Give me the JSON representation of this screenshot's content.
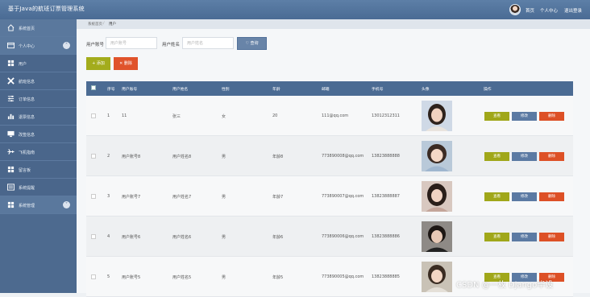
{
  "app": {
    "title": "基于Java的航班订票管理系统"
  },
  "header": {
    "links": [
      "首页",
      "个人中心",
      "退出登录"
    ]
  },
  "sidebar": {
    "items": [
      {
        "label": "系统首页",
        "icon": "home-icon",
        "kind": "top"
      },
      {
        "label": "个人中心",
        "icon": "id-card-icon",
        "kind": "top",
        "expandable": true
      },
      {
        "label": "用户",
        "icon": "grid-icon",
        "kind": "sub"
      },
      {
        "label": "航班信息",
        "icon": "plane-x-icon",
        "kind": "sub"
      },
      {
        "label": "订单信息",
        "icon": "sliders-icon",
        "kind": "sub"
      },
      {
        "label": "退票信息",
        "icon": "bar-chart-icon",
        "kind": "sub"
      },
      {
        "label": "改签信息",
        "icon": "monitor-icon",
        "kind": "sub"
      },
      {
        "label": "飞机指南",
        "icon": "plane-icon",
        "kind": "sub"
      },
      {
        "label": "留言板",
        "icon": "grid-icon",
        "kind": "sub"
      },
      {
        "label": "系统提醒",
        "icon": "list-icon",
        "kind": "sub"
      },
      {
        "label": "系统管理",
        "icon": "grid-icon",
        "kind": "top",
        "expandable": true
      }
    ]
  },
  "breadcrumb": {
    "home": "系统首页",
    "current": "用户"
  },
  "filters": {
    "account_label": "用户账号",
    "account_placeholder": "用户账号",
    "name_label": "用户姓名",
    "name_placeholder": "用户姓名",
    "search_label": "查询"
  },
  "toolbar": {
    "add_label": "添加",
    "delete_label": "删除"
  },
  "table": {
    "columns": [
      "序号",
      "用户账号",
      "用户姓名",
      "性别",
      "年龄",
      "邮箱",
      "手机号",
      "头像",
      "操作"
    ],
    "rows": [
      {
        "index": "1",
        "account": "11",
        "name": "张三",
        "gender": "女",
        "age": "20",
        "email": "111@qq.com",
        "phone": "13012312311"
      },
      {
        "index": "2",
        "account": "用户账号8",
        "name": "用户姓名8",
        "gender": "男",
        "age": "年龄8",
        "email": "773890008@qq.com",
        "phone": "13823888888"
      },
      {
        "index": "3",
        "account": "用户账号7",
        "name": "用户姓名7",
        "gender": "男",
        "age": "年龄7",
        "email": "773890007@qq.com",
        "phone": "13823888887"
      },
      {
        "index": "4",
        "account": "用户账号6",
        "name": "用户姓名6",
        "gender": "男",
        "age": "年龄6",
        "email": "773890006@qq.com",
        "phone": "13823888886"
      },
      {
        "index": "5",
        "account": "用户账号5",
        "name": "用户姓名5",
        "gender": "男",
        "age": "年龄5",
        "email": "773890005@qq.com",
        "phone": "13823888885"
      }
    ],
    "actions": {
      "view": "查看",
      "edit": "修改",
      "delete": "删除"
    }
  },
  "watermark": "CSDN @一枚 Django毕设",
  "colors": {
    "header": "#4a6b94",
    "sidebar": "#4d6a8f",
    "table_header": "#4b6b93",
    "view_btn": "#a0a71a",
    "edit_btn": "#5b7aa3",
    "delete_btn": "#dd5026"
  }
}
